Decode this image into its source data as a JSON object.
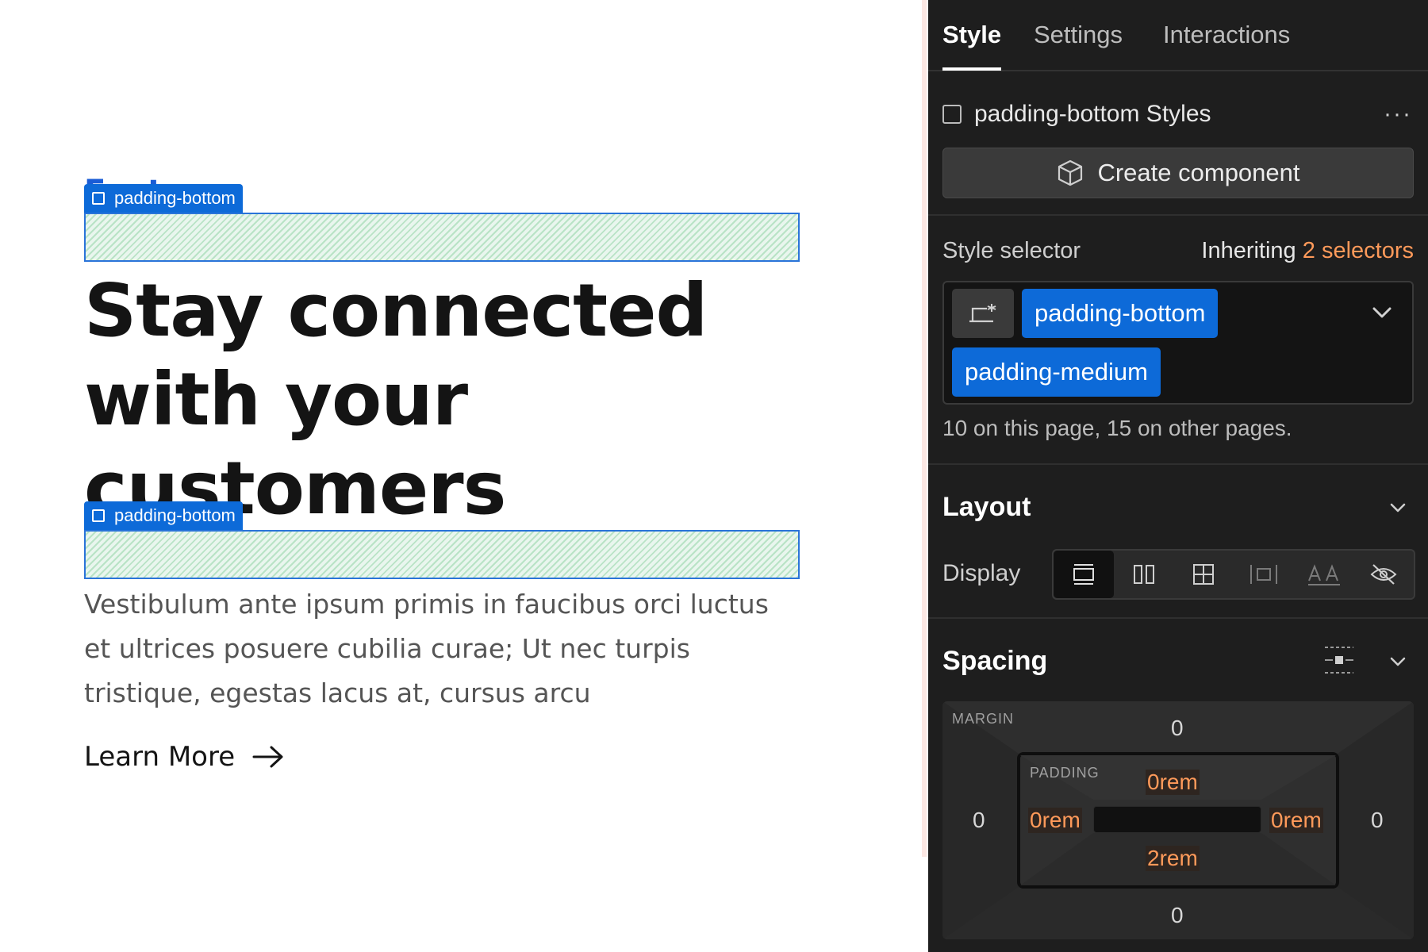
{
  "canvas": {
    "cut_text": "Feat",
    "badge_top": "padding-bottom",
    "badge_bottom": "padding-bottom",
    "heading": "Stay connected\nwith your\ncustomers",
    "body": "Vestibulum ante ipsum primis in faucibus orci luctus et ultrices posuere cubilia curae; Ut nec turpis tristique, egestas lacus at, cursus arcu",
    "learn_more": "Learn More"
  },
  "panel": {
    "tabs": [
      "Style",
      "Settings",
      "Interactions"
    ],
    "component_title": "padding-bottom Styles",
    "more": "···",
    "create_component": "Create component",
    "style_selector_label": "Style selector",
    "inheriting_prefix": "Inheriting",
    "inheriting_count": "2 selectors",
    "chips": [
      "padding-bottom",
      "padding-medium"
    ],
    "usage": "10 on this page, 15 on other pages.",
    "layout_title": "Layout",
    "display_label": "Display",
    "spacing_title": "Spacing",
    "margin_label": "MARGIN",
    "padding_label": "PADDING",
    "margin": {
      "top": "0",
      "right": "0",
      "bottom": "0",
      "left": "0"
    },
    "padding": {
      "top": "0rem",
      "right": "0rem",
      "bottom": "2rem",
      "left": "0rem"
    }
  },
  "colors": {
    "accent": "#0d6ad8",
    "orange": "#ff9a5a",
    "panel_bg": "#1e1e1e"
  }
}
